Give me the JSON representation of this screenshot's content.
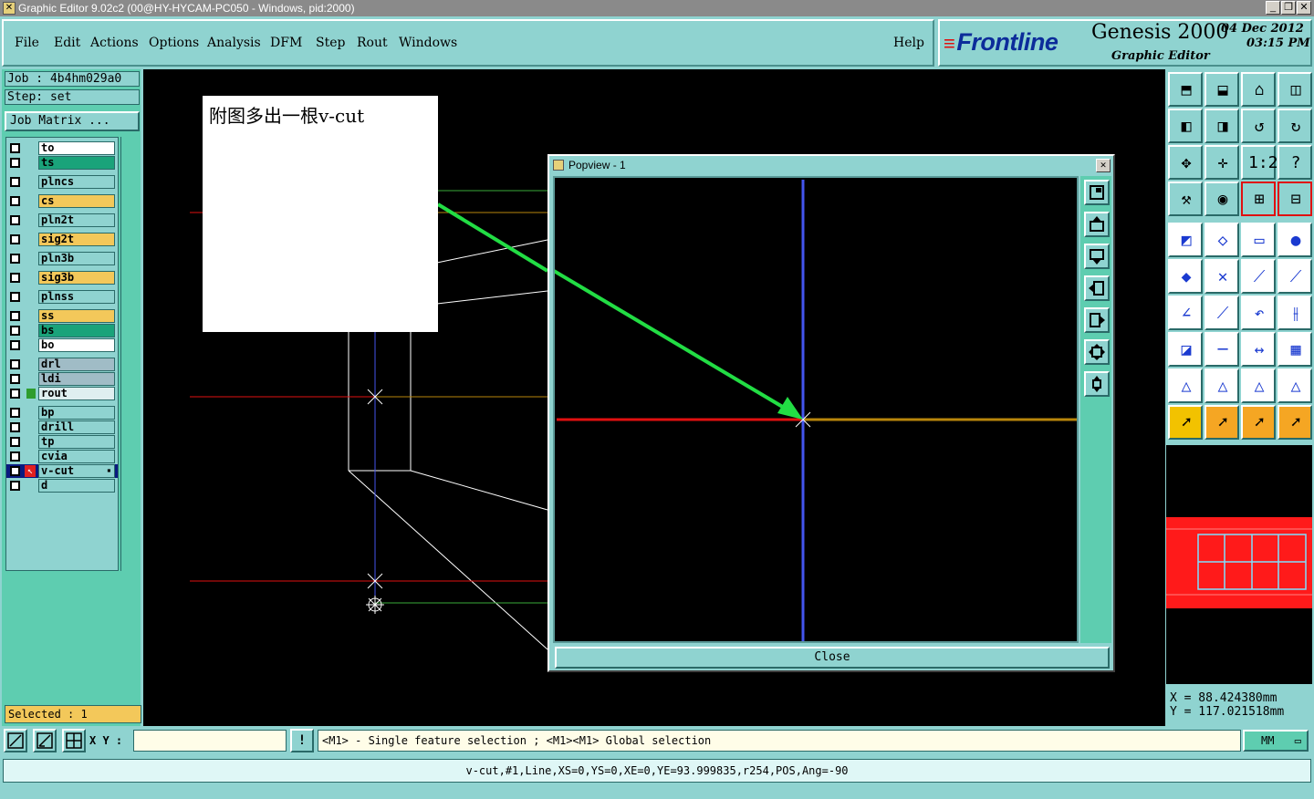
{
  "window": {
    "title": "Graphic Editor 9.02c2 (00@HY-HYCAM-PC050 - Windows, pid:2000)",
    "buttons": [
      "_",
      "❐",
      "✕"
    ]
  },
  "menu": {
    "items": [
      "File",
      "Edit",
      "Actions",
      "Options",
      "Analysis",
      "DFM",
      "Step",
      "Rout",
      "Windows"
    ],
    "help": "Help"
  },
  "brand": {
    "logo": "Frontline",
    "product": "Genesis 2000",
    "subtitle": "Graphic Editor",
    "date": "04 Dec 2012",
    "time": "03:15 PM"
  },
  "job": {
    "job_label": "Job : 4b4hm029a0",
    "step_label": "Step: set",
    "matrix_button": "Job Matrix ..."
  },
  "layers": [
    {
      "name": "to",
      "color": "#ffffff"
    },
    {
      "name": "ts",
      "color": "#1aa37a"
    },
    {
      "name": "plncs",
      "color": "#8fd3d0"
    },
    {
      "name": "cs",
      "color": "#f3c85a"
    },
    {
      "name": "pln2t",
      "color": "#8fd3d0"
    },
    {
      "name": "sig2t",
      "color": "#f3c85a"
    },
    {
      "name": "pln3b",
      "color": "#8fd3d0"
    },
    {
      "name": "sig3b",
      "color": "#f3c85a"
    },
    {
      "name": "plnss",
      "color": "#8fd3d0"
    },
    {
      "name": "ss",
      "color": "#f3c85a"
    },
    {
      "name": "bs",
      "color": "#1aa37a"
    },
    {
      "name": "bo",
      "color": "#ffffff"
    },
    {
      "name": "drl",
      "color": "#a0bcc6"
    },
    {
      "name": "ldi",
      "color": "#a0bcc6"
    },
    {
      "name": "rout",
      "color": "#dfeff0"
    },
    {
      "name": "bp",
      "color": "#8fd3d0"
    },
    {
      "name": "drill",
      "color": "#8fd3d0"
    },
    {
      "name": "tp",
      "color": "#8fd3d0"
    },
    {
      "name": "cvia",
      "color": "#8fd3d0"
    },
    {
      "name": "v-cut",
      "color": "#8fd3d0",
      "active": true
    },
    {
      "name": "d",
      "color": "#8fd3d0"
    }
  ],
  "selected": "Selected : 1",
  "note": "附图多出一根v-cut",
  "popview": {
    "title": "Popview - 1",
    "close": "Close"
  },
  "coords": {
    "x": "X  =  88.424380mm",
    "y": "Y  = 117.021518mm"
  },
  "bottom": {
    "xy_label": "X Y :",
    "xy_value": "",
    "warn": "!",
    "message": "<M1> - Single feature selection ; <M1><M1> Global selection",
    "units": "MM"
  },
  "status": "v-cut,#1,Line,XS=0,YS=0,XE=0,YE=93.999835,r254,POS,Ang=-90",
  "colors": {
    "panel": "#8fd3d0",
    "panel_dark": "#5ecdb0",
    "highlight_yellow": "#f3c85a",
    "arrow_green": "#22dd44",
    "vcut_blue": "#4455ee"
  }
}
